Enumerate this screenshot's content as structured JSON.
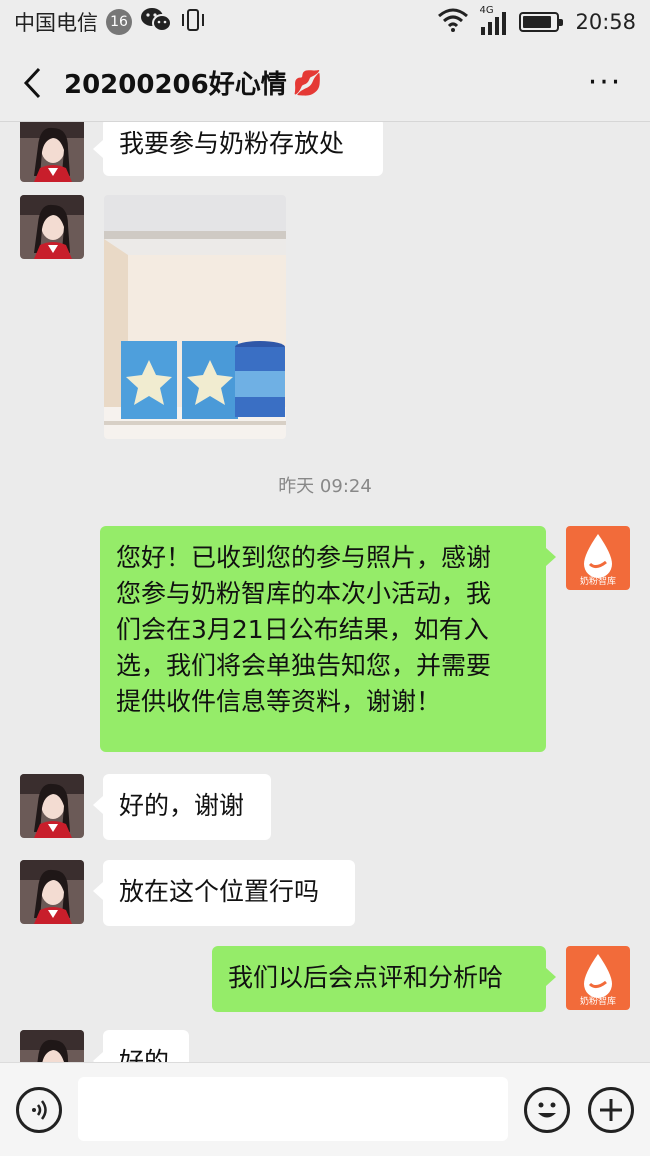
{
  "status_bar": {
    "carrier": "中国电信",
    "notification_count": "16",
    "network": "4G",
    "time": "20:58"
  },
  "header": {
    "title": "20200206好心情",
    "title_emoji": "💋",
    "more": "···"
  },
  "messages": [
    {
      "side": "in",
      "type": "text",
      "text": "我要参与奶粉存放处"
    },
    {
      "side": "in",
      "type": "image",
      "image_description": "shelf-photo"
    },
    {
      "type": "timestamp",
      "text": "昨天 09:24"
    },
    {
      "side": "out",
      "type": "text",
      "lines": [
        "您好！已收到您的参与照片，感谢",
        "您参与奶粉智库的本次小活动，我",
        "们会在3月21日公布结果，如有入",
        "选，我们将会单独告知您，并需要",
        "提供收件信息等资料，谢谢！"
      ]
    },
    {
      "side": "in",
      "type": "text",
      "text": "好的，谢谢"
    },
    {
      "side": "in",
      "type": "text",
      "text": "放在这个位置行吗"
    },
    {
      "side": "out",
      "type": "text",
      "text": "我们以后会点评和分析哈"
    },
    {
      "side": "in",
      "type": "text",
      "text": "好的"
    }
  ],
  "brand_avatar": {
    "label": "奶粉智库",
    "color": "#f26b3a"
  },
  "input_bar": {
    "placeholder": ""
  },
  "colors": {
    "out_bubble": "#95ec69",
    "in_bubble": "#ffffff",
    "background": "#ebebeb"
  }
}
